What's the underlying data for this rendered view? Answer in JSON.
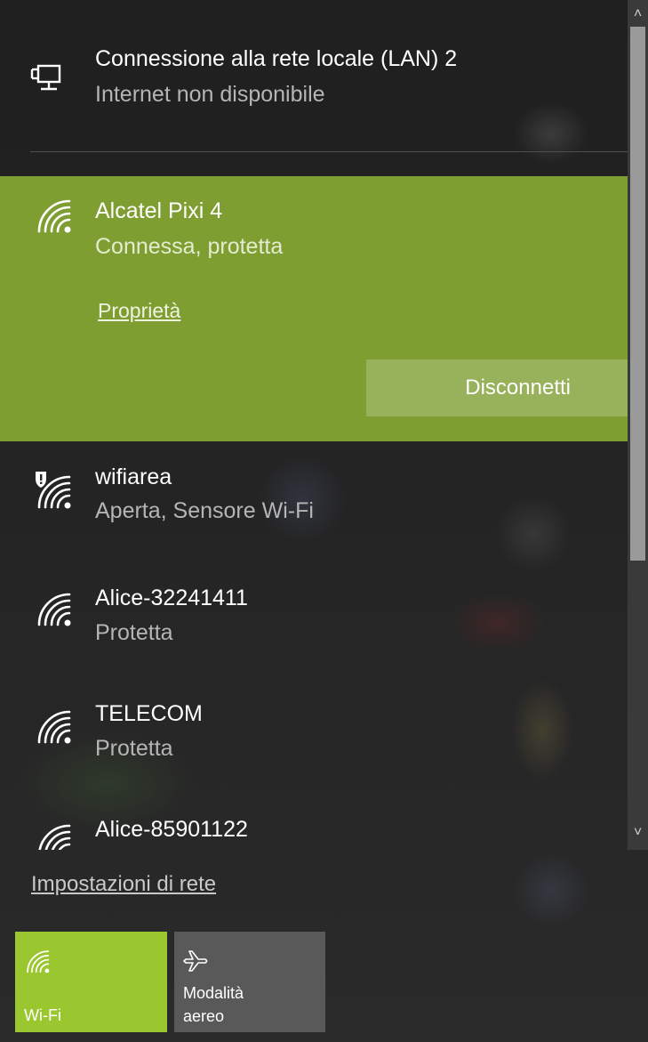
{
  "lan": {
    "title": "Connessione alla rete locale (LAN) 2",
    "status": "Internet non disponibile",
    "icon": "ethernet-icon"
  },
  "connected": {
    "ssid": "Alcatel Pixi 4",
    "status": "Connessa, protetta",
    "properties_label": "Proprietà",
    "disconnect_label": "Disconnetti",
    "icon": "wifi-icon",
    "accent": "#7f9e32"
  },
  "networks": [
    {
      "ssid": "wifiarea",
      "status": "Aperta, Sensore Wi-Fi",
      "icon": "wifi-open-shield-icon"
    },
    {
      "ssid": "Alice-32241411",
      "status": "Protetta",
      "icon": "wifi-icon"
    },
    {
      "ssid": "TELECOM",
      "status": "Protetta",
      "icon": "wifi-icon"
    },
    {
      "ssid": "Alice-85901122",
      "status": "",
      "icon": "wifi-icon"
    }
  ],
  "network_settings_label": "Impostazioni di rete",
  "quick_actions": {
    "wifi_label": "Wi-Fi",
    "airplane_label_line1": "Modalità",
    "airplane_label_line2": "aereo",
    "wifi_color": "#9ac72f"
  }
}
